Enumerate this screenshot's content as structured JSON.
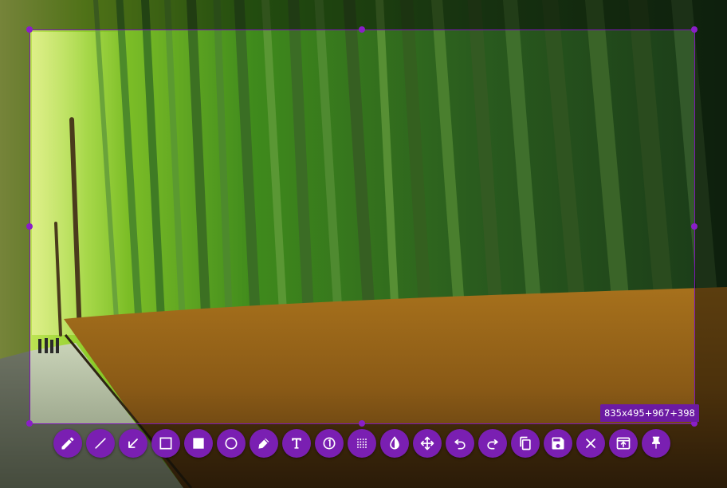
{
  "app": {
    "name": "screenshot-capture-overlay"
  },
  "selection": {
    "size_text": "835x495+967+398"
  },
  "accent_color": "#7a1fb2",
  "toolbar": {
    "tools": [
      {
        "name": "pencil-tool-button",
        "icon": "pencil-icon"
      },
      {
        "name": "line-tool-button",
        "icon": "line-icon"
      },
      {
        "name": "arrow-tool-button",
        "icon": "arrow-icon"
      },
      {
        "name": "rectangle-outline-tool-button",
        "icon": "square-outline-icon"
      },
      {
        "name": "rectangle-filled-tool-button",
        "icon": "square-filled-icon"
      },
      {
        "name": "circle-tool-button",
        "icon": "circle-outline-icon"
      },
      {
        "name": "marker-tool-button",
        "icon": "marker-icon"
      },
      {
        "name": "text-tool-button",
        "icon": "text-icon"
      },
      {
        "name": "counter-tool-button",
        "icon": "counter-icon"
      },
      {
        "name": "pixelate-tool-button",
        "icon": "pixelate-icon"
      },
      {
        "name": "invert-tool-button",
        "icon": "invert-icon"
      },
      {
        "name": "move-selection-button",
        "icon": "move-icon"
      },
      {
        "name": "undo-button",
        "icon": "undo-icon"
      },
      {
        "name": "redo-button",
        "icon": "redo-icon"
      },
      {
        "name": "copy-clipboard-button",
        "icon": "copy-icon"
      },
      {
        "name": "save-button",
        "icon": "save-icon"
      },
      {
        "name": "exit-button",
        "icon": "close-icon"
      },
      {
        "name": "open-app-button",
        "icon": "open-in-app-icon"
      },
      {
        "name": "pin-button",
        "icon": "pin-icon"
      }
    ]
  }
}
